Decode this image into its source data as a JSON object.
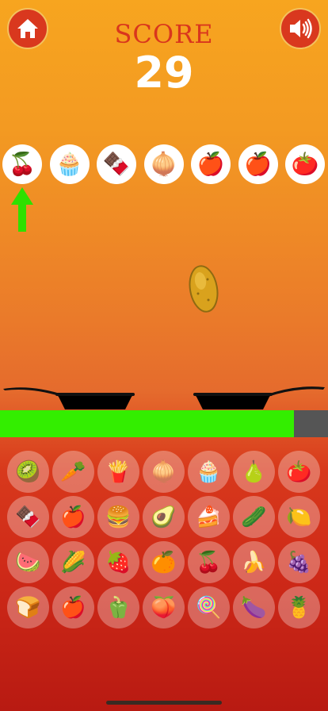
{
  "header": {
    "score_label": "SCORE",
    "score_value": "29",
    "home_icon": "home-icon",
    "sound_icon": "speaker-icon",
    "button_color": "#d9381e"
  },
  "queue": [
    {
      "name": "cherries",
      "glyph": "🍒"
    },
    {
      "name": "cupcake",
      "glyph": "🧁"
    },
    {
      "name": "chocolate",
      "glyph": "🍫"
    },
    {
      "name": "onion",
      "glyph": "🧅"
    },
    {
      "name": "pomegranate",
      "glyph": "🍎"
    },
    {
      "name": "apple",
      "glyph": "🍎"
    },
    {
      "name": "tomato",
      "glyph": "🍅"
    }
  ],
  "queue_indicator": {
    "icon": "green-up-arrow-icon",
    "target": "cherries",
    "color": "#2fe000"
  },
  "falling_item": {
    "name": "potato",
    "icon": "potato-icon"
  },
  "progress": {
    "fraction": 0.895,
    "fill_color": "#33ee00",
    "track_color": "#555555"
  },
  "pans": [
    "left-pan",
    "right-pan"
  ],
  "grid": [
    [
      {
        "name": "kiwi",
        "glyph": "🥝"
      },
      {
        "name": "carrot",
        "glyph": "🥕"
      },
      {
        "name": "fries",
        "glyph": "🍟"
      },
      {
        "name": "onion",
        "glyph": "🧅"
      },
      {
        "name": "cupcake",
        "glyph": "🧁"
      },
      {
        "name": "pear",
        "glyph": "🍐"
      },
      {
        "name": "tomato",
        "glyph": "🍅"
      }
    ],
    [
      {
        "name": "chocolate",
        "glyph": "🍫"
      },
      {
        "name": "pomegranate",
        "glyph": "🍎"
      },
      {
        "name": "burger",
        "glyph": "🍔"
      },
      {
        "name": "avocado",
        "glyph": "🥑"
      },
      {
        "name": "cake",
        "glyph": "🍰"
      },
      {
        "name": "cucumber",
        "glyph": "🥒"
      },
      {
        "name": "lemon",
        "glyph": "🍋"
      }
    ],
    [
      {
        "name": "watermelon",
        "glyph": "🍉"
      },
      {
        "name": "corn",
        "glyph": "🌽"
      },
      {
        "name": "strawberry",
        "glyph": "🍓"
      },
      {
        "name": "orange",
        "glyph": "🍊"
      },
      {
        "name": "cherries",
        "glyph": "🍒"
      },
      {
        "name": "banana",
        "glyph": "🍌"
      },
      {
        "name": "grapes",
        "glyph": "🍇"
      }
    ],
    [
      {
        "name": "bread",
        "glyph": "🍞"
      },
      {
        "name": "apple",
        "glyph": "🍎"
      },
      {
        "name": "bell-pepper",
        "glyph": "🫑"
      },
      {
        "name": "plum",
        "glyph": "🍑"
      },
      {
        "name": "lollipop",
        "glyph": "🍭"
      },
      {
        "name": "eggplant",
        "glyph": "🍆"
      },
      {
        "name": "pineapple",
        "glyph": "🍍"
      }
    ]
  ]
}
